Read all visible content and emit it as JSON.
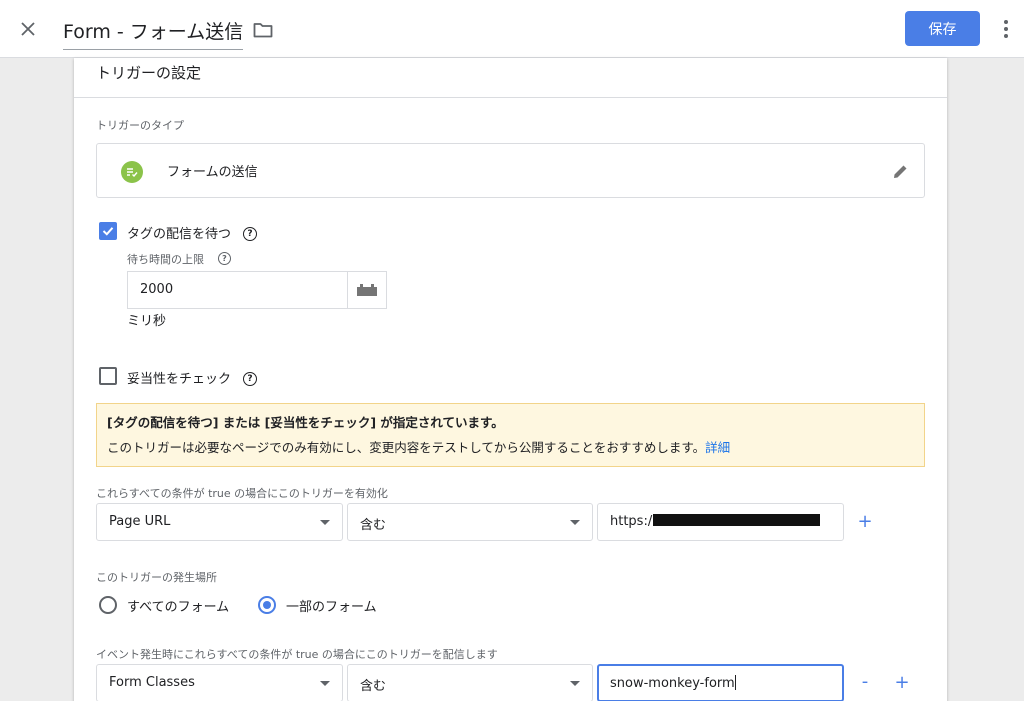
{
  "header": {
    "title": "Form - フォーム送信",
    "save_label": "保存"
  },
  "card": {
    "title": "トリガーの設定",
    "trigger_type_label": "トリガーのタイプ",
    "trigger_type_name": "フォームの送信",
    "wait_for_tags": {
      "label": "タグの配信を待つ",
      "checked": true,
      "max_wait_label": "待ち時間の上限",
      "max_wait_value": "2000",
      "unit": "ミリ秒"
    },
    "check_validation": {
      "label": "妥当性をチェック",
      "checked": false
    },
    "notice": {
      "title": "[タグの配信を待つ] または [妥当性をチェック] が指定されています。",
      "body": "このトリガーは必要なページでのみ有効にし、変更内容をテストしてから公開することをおすすめします。",
      "link": "詳細"
    },
    "enable_conditions": {
      "label": "これらすべての条件が true の場合にこのトリガーを有効化",
      "variable": "Page URL",
      "operator": "含む",
      "value_prefix": "https:/"
    },
    "fires_on": {
      "label": "このトリガーの発生場所",
      "options": [
        "すべてのフォーム",
        "一部のフォーム"
      ],
      "selected": "一部のフォーム"
    },
    "fire_conditions": {
      "label": "イベント発生時にこれらすべての条件が true の場合にこのトリガーを配信します",
      "variable": "Form Classes",
      "operator": "含む",
      "value": "snow-monkey-form"
    },
    "plus_symbol": "+",
    "minus_symbol": "-",
    "help_symbol": "?"
  },
  "colors": {
    "accent": "#4a7ee6",
    "trigger_icon": "#8bc34a",
    "notice_bg": "#fef7e0"
  }
}
